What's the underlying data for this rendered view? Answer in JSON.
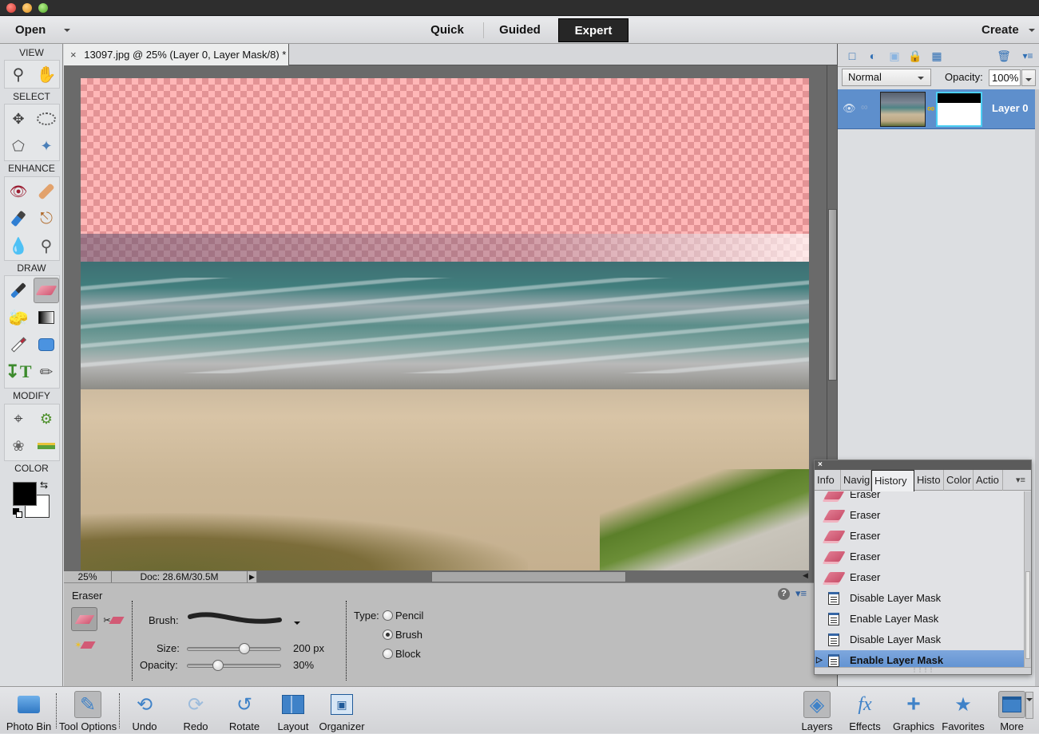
{
  "window": {
    "traffic_lights": {
      "close": "#e0443e",
      "minimize": "#e8a021",
      "zoom": "#5fbc2f"
    }
  },
  "topbar": {
    "open_label": "Open",
    "modes": [
      {
        "label": "Quick",
        "active": false
      },
      {
        "label": "Guided",
        "active": false
      },
      {
        "label": "Expert",
        "active": true
      }
    ],
    "create_label": "Create"
  },
  "toolbox": {
    "sections": {
      "view": "VIEW",
      "select": "SELECT",
      "enhance": "ENHANCE",
      "draw": "DRAW",
      "modify": "MODIFY",
      "color": "COLOR"
    },
    "tools": {
      "view": [
        "zoom-tool",
        "hand-tool"
      ],
      "select": [
        "move-tool",
        "elliptical-marquee-tool",
        "polygonal-lasso-tool",
        "quick-selection-tool"
      ],
      "enhance": [
        "red-eye-tool",
        "spot-healing-brush-tool",
        "smart-brush-tool",
        "clone-stamp-tool",
        "blur-tool",
        "sponge-tool"
      ],
      "draw": [
        "brush-tool",
        "eraser-tool",
        "paint-bucket-tool",
        "gradient-tool",
        "eyedropper-tool",
        "shape-tool",
        "type-tool",
        "pencil-tool"
      ],
      "modify": [
        "crop-tool",
        "recompose-tool",
        "content-aware-move-tool",
        "straighten-tool"
      ]
    },
    "selected_tool": "eraser-tool",
    "foreground_color": "#000000",
    "background_color": "#ffffff"
  },
  "document": {
    "tab_title": "13097.jpg @ 25% (Layer 0, Layer Mask/8) *",
    "close_glyph": "×"
  },
  "statusbar": {
    "zoom": "25%",
    "doc_size": "Doc: 28.6M/30.5M"
  },
  "tool_options": {
    "tool_name": "Eraser",
    "brush_label": "Brush:",
    "size_label": "Size:",
    "size_value": "200 px",
    "size_fraction": 0.62,
    "opacity_label": "Opacity:",
    "opacity_value": "30%",
    "opacity_fraction": 0.3,
    "type_label": "Type:",
    "types": [
      {
        "label": "Pencil",
        "selected": false
      },
      {
        "label": "Brush",
        "selected": true
      },
      {
        "label": "Block",
        "selected": false
      }
    ],
    "eraser_variants": [
      "eraser",
      "background-eraser",
      "magic-eraser"
    ]
  },
  "layers": {
    "blend_mode": "Normal",
    "opacity_label": "Opacity:",
    "opacity_value": "100%",
    "layer_name": "Layer 0",
    "accent": "#5e8fcc"
  },
  "history": {
    "close_glyph": "×",
    "tabs": [
      {
        "label": "Info",
        "active": false
      },
      {
        "label": "Navig",
        "active": false
      },
      {
        "label": "History",
        "active": true
      },
      {
        "label": "Histo",
        "active": false
      },
      {
        "label": "Color",
        "active": false
      },
      {
        "label": "Actio",
        "active": false
      }
    ],
    "items": [
      {
        "label": "Eraser",
        "icon": "eraser",
        "selected": false
      },
      {
        "label": "Eraser",
        "icon": "eraser",
        "selected": false
      },
      {
        "label": "Eraser",
        "icon": "eraser",
        "selected": false
      },
      {
        "label": "Eraser",
        "icon": "eraser",
        "selected": false
      },
      {
        "label": "Eraser",
        "icon": "eraser",
        "selected": false
      },
      {
        "label": "Disable Layer Mask",
        "icon": "mask",
        "selected": false
      },
      {
        "label": "Enable Layer Mask",
        "icon": "mask",
        "selected": false
      },
      {
        "label": "Disable Layer Mask",
        "icon": "mask",
        "selected": false
      },
      {
        "label": "Enable Layer Mask",
        "icon": "mask",
        "selected": true
      }
    ]
  },
  "bottombar": {
    "left": [
      {
        "label": "Photo Bin",
        "icon": "photo-bin"
      },
      {
        "label": "Tool Options",
        "icon": "tool-options",
        "active": true
      },
      {
        "label": "Undo",
        "icon": "undo"
      },
      {
        "label": "Redo",
        "icon": "redo"
      },
      {
        "label": "Rotate",
        "icon": "rotate"
      },
      {
        "label": "Layout",
        "icon": "layout"
      },
      {
        "label": "Organizer",
        "icon": "organizer"
      }
    ],
    "right": [
      {
        "label": "Layers",
        "icon": "layers",
        "active": true
      },
      {
        "label": "Effects",
        "icon": "effects"
      },
      {
        "label": "Graphics",
        "icon": "graphics"
      },
      {
        "label": "Favorites",
        "icon": "favorites"
      },
      {
        "label": "More",
        "icon": "more"
      }
    ]
  }
}
